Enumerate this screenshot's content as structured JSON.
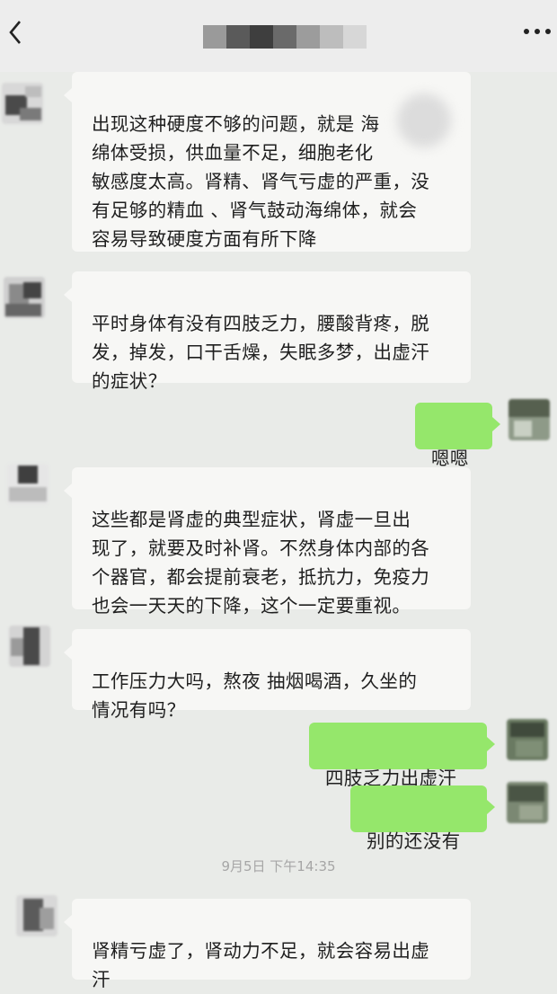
{
  "header": {
    "title": "",
    "back_icon": "chevron-left-icon",
    "more_icon": "ellipsis-icon"
  },
  "messages": [
    {
      "side": "left",
      "text": "出现这种硬度不够的问题，就是    海\n绵体受损，供血量不足，细胞老化\n敏感度太高。肾精、肾气亏虚的严重，没\n有足够的精血 、肾气鼓动海绵体，就会\n容易导致硬度方面有所下降"
    },
    {
      "side": "left",
      "text": "平时身体有没有四肢乏力，腰酸背疼，脱\n发，掉发，口干舌燥，失眠多梦，出虚汗\n的症状？"
    },
    {
      "side": "right",
      "text": "嗯嗯"
    },
    {
      "side": "left",
      "text": "这些都是肾虚的典型症状，肾虚一旦出\n现了，就要及时补肾。不然身体内部的各\n个器官，都会提前衰老，抵抗力，免疫力\n也会一天天的下降，这个一定要重视。"
    },
    {
      "side": "left",
      "text": "工作压力大吗，熬夜  抽烟喝酒，久坐的\n情况有吗？"
    },
    {
      "side": "right",
      "text": "四肢乏力出虚汗"
    },
    {
      "side": "right",
      "text": "别的还没有"
    },
    {
      "side": "left",
      "text": "肾精亏虚了，肾动力不足，就会容易出虚\n汗"
    }
  ],
  "timestamp": "9月5日 下午14:35",
  "colors": {
    "background": "#e9ebe8",
    "left_bubble": "#f7f7f5",
    "right_bubble": "#95e76b",
    "timestamp": "#a6a6a6"
  }
}
